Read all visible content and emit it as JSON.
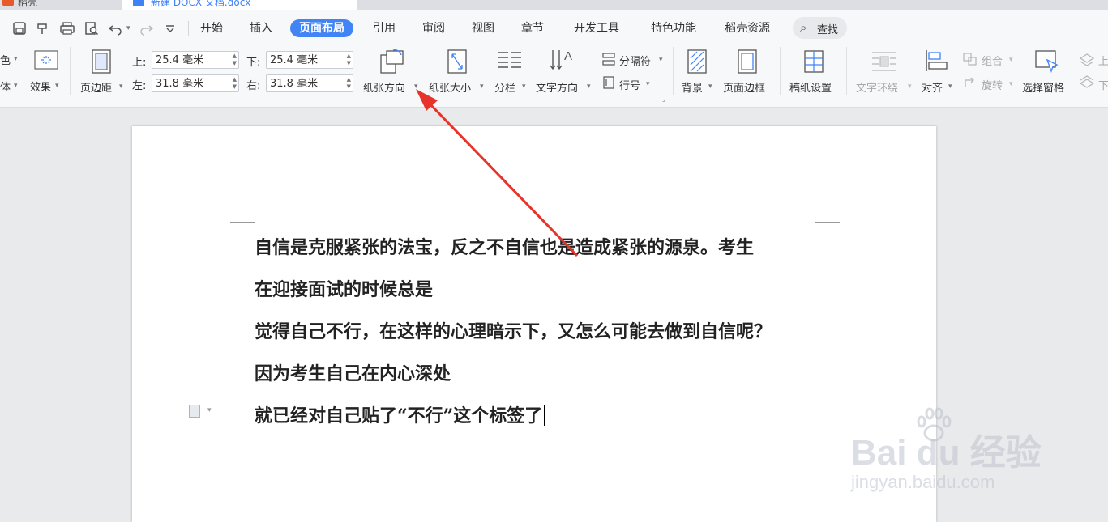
{
  "tabs": {
    "app_tab": "稻壳",
    "doc_tab": "新建 DOCX 文档.docx"
  },
  "menu": {
    "items": [
      "开始",
      "插入",
      "页面布局",
      "引用",
      "审阅",
      "视图",
      "章节",
      "开发工具",
      "特色功能",
      "稻壳资源"
    ],
    "active": "页面布局",
    "search_label": "查找"
  },
  "ribbon": {
    "theme_color": "色",
    "theme_font": "体",
    "effects": "效果",
    "margins_label": "页边距",
    "top_label": "上:",
    "top_value": "25.4 毫米",
    "bottom_label": "下:",
    "bottom_value": "25.4 毫米",
    "left_label": "左:",
    "left_value": "31.8 毫米",
    "right_label": "右:",
    "right_value": "31.8 毫米",
    "orientation": "纸张方向",
    "paper_size": "纸张大小",
    "columns": "分栏",
    "text_direction": "文字方向",
    "breaks": "分隔符",
    "line_numbers": "行号",
    "background": "背景",
    "page_border": "页面边框",
    "manuscript": "稿纸设置",
    "text_wrap": "文字环绕",
    "align": "对齐",
    "group": "组合",
    "rotate": "旋转",
    "selection_pane": "选择窗格",
    "up": "上",
    "down": "下"
  },
  "document": {
    "lines": [
      "自信是克服紧张的法宝，反之不自信也是造成紧张的源泉。考生",
      "在迎接面试的时候总是",
      "觉得自己不行，在这样的心理暗示下，又怎么可能去做到自信呢？",
      "因为考生自己在内心深处",
      "就已经对自己贴了“不行”这个标签了"
    ]
  },
  "watermark": {
    "brand": "Bai  du 经验",
    "url": "jingyan.baidu.com"
  },
  "colors": {
    "accent": "#4184f5",
    "arrow": "#e8332a"
  }
}
